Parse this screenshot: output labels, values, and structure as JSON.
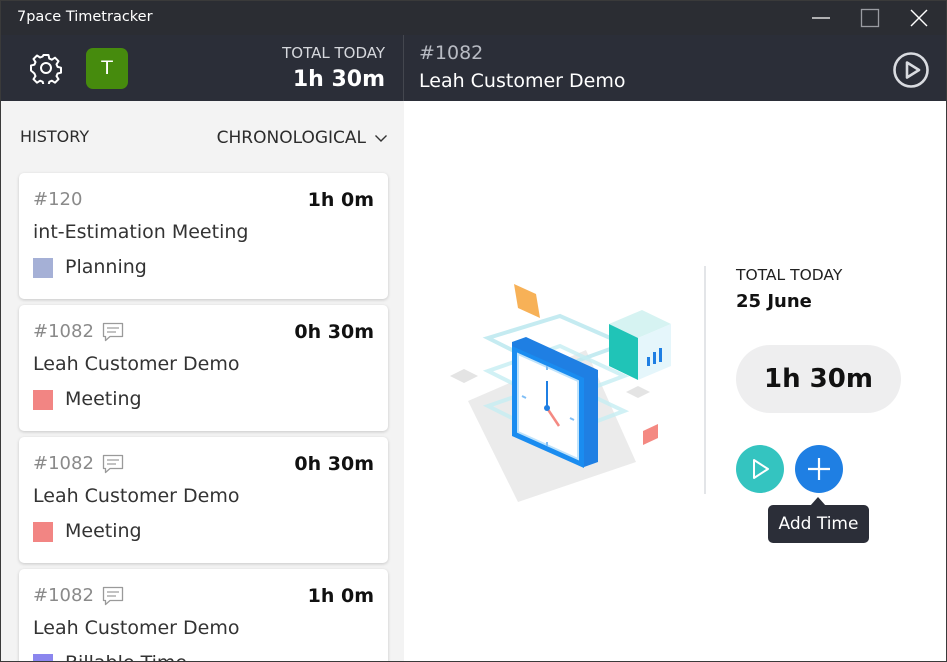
{
  "window": {
    "title": "7pace Timetracker"
  },
  "header": {
    "avatar_initial": "T",
    "total_label": "TOTAL TODAY",
    "total_value": "1h 30m",
    "task_id": "#1082",
    "task_name": "Leah Customer Demo"
  },
  "sidebar": {
    "history_label": "HISTORY",
    "sort_label": "CHRONOLOGICAL",
    "entries": [
      {
        "id": "#120",
        "duration": "1h 0m",
        "name": "int-Estimation Meeting",
        "category": "Planning",
        "category_color": "#a5b0d6",
        "has_comment": false
      },
      {
        "id": "#1082",
        "duration": "0h 30m",
        "name": "Leah Customer Demo",
        "category": "Meeting",
        "category_color": "#f28583",
        "has_comment": true
      },
      {
        "id": "#1082",
        "duration": "0h 30m",
        "name": "Leah Customer Demo",
        "category": "Meeting",
        "category_color": "#f28583",
        "has_comment": true
      },
      {
        "id": "#1082",
        "duration": "1h 0m",
        "name": "Leah Customer Demo",
        "category": "Billable Time",
        "category_color": "#8b86ee",
        "has_comment": true
      }
    ]
  },
  "main": {
    "total_label": "TOTAL TODAY",
    "date": "25 June",
    "total_time": "1h 30m",
    "add_time_tooltip": "Add Time"
  },
  "colors": {
    "header_bg": "#2b2e38",
    "play_button": "#34c4c0",
    "add_button": "#1f7fe3",
    "avatar": "#468b0d"
  }
}
